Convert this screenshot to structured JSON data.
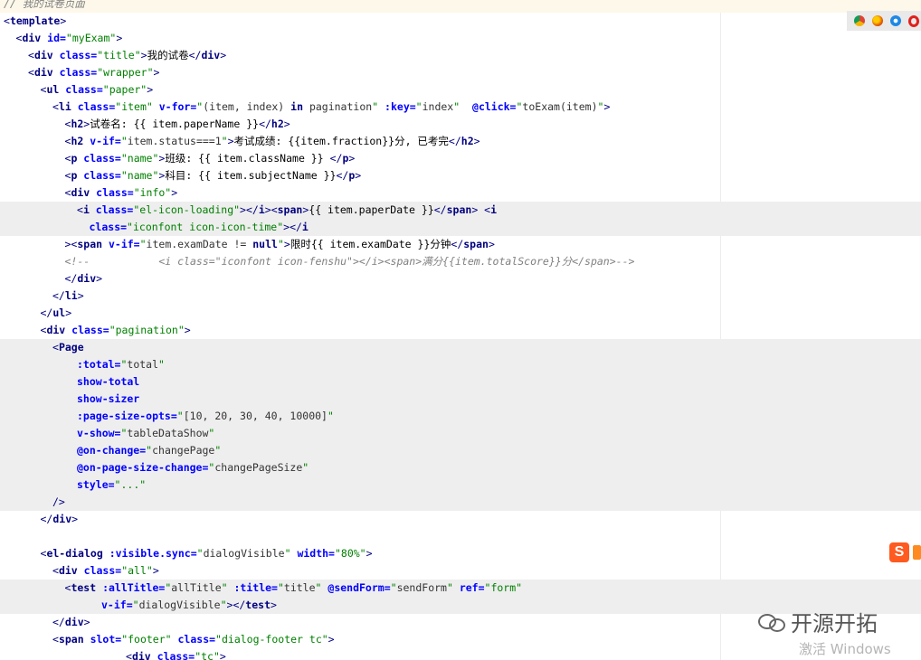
{
  "lines": [
    {
      "indent": 0,
      "hl": "first",
      "segs": [
        [
          "cmt",
          "// 我的试卷页面"
        ]
      ]
    },
    {
      "indent": 0,
      "hl": "",
      "segs": [
        [
          "tag",
          "<"
        ],
        [
          "kw",
          "template"
        ],
        [
          "tag",
          ">"
        ]
      ]
    },
    {
      "indent": 1,
      "hl": "",
      "segs": [
        [
          "tag",
          "<"
        ],
        [
          "kw",
          "div "
        ],
        [
          "attr",
          "id="
        ],
        [
          "val",
          "\"myExam\""
        ],
        [
          "tag",
          ">"
        ]
      ]
    },
    {
      "indent": 2,
      "hl": "",
      "segs": [
        [
          "tag",
          "<"
        ],
        [
          "kw",
          "div "
        ],
        [
          "attr",
          "class="
        ],
        [
          "val",
          "\"title\""
        ],
        [
          "tag",
          ">"
        ],
        [
          "txt",
          "我的试卷"
        ],
        [
          "tag",
          "</"
        ],
        [
          "kw",
          "div"
        ],
        [
          "tag",
          ">"
        ]
      ]
    },
    {
      "indent": 2,
      "hl": "",
      "segs": [
        [
          "tag",
          "<"
        ],
        [
          "kw",
          "div "
        ],
        [
          "attr",
          "class="
        ],
        [
          "val",
          "\"wrapper\""
        ],
        [
          "tag",
          ">"
        ]
      ]
    },
    {
      "indent": 3,
      "hl": "",
      "segs": [
        [
          "tag",
          "<"
        ],
        [
          "kw",
          "ul "
        ],
        [
          "attr",
          "class="
        ],
        [
          "val",
          "\"paper\""
        ],
        [
          "tag",
          ">"
        ]
      ]
    },
    {
      "indent": 4,
      "hl": "",
      "segs": [
        [
          "tag",
          "<"
        ],
        [
          "kw",
          "li "
        ],
        [
          "attr",
          "class="
        ],
        [
          "val",
          "\"item\" "
        ],
        [
          "attr",
          "v-for="
        ],
        [
          "val",
          "\""
        ],
        [
          "plain",
          "(item, index) "
        ],
        [
          "kw",
          "in "
        ],
        [
          "plain",
          "pagination"
        ],
        [
          "val",
          "\" "
        ],
        [
          "attr",
          ":key="
        ],
        [
          "val",
          "\""
        ],
        [
          "plain",
          "index"
        ],
        [
          "val",
          "\"  "
        ],
        [
          "attr",
          "@click="
        ],
        [
          "val",
          "\""
        ],
        [
          "plain",
          "toExam(item)"
        ],
        [
          "val",
          "\""
        ],
        [
          "tag",
          ">"
        ]
      ]
    },
    {
      "indent": 5,
      "hl": "",
      "segs": [
        [
          "tag",
          "<"
        ],
        [
          "kw",
          "h2"
        ],
        [
          "tag",
          ">"
        ],
        [
          "txt",
          "试卷名: {{ item.paperName }}"
        ],
        [
          "tag",
          "</"
        ],
        [
          "kw",
          "h2"
        ],
        [
          "tag",
          ">"
        ]
      ]
    },
    {
      "indent": 5,
      "hl": "",
      "segs": [
        [
          "tag",
          "<"
        ],
        [
          "kw",
          "h2 "
        ],
        [
          "attr",
          "v-if="
        ],
        [
          "val",
          "\""
        ],
        [
          "plain",
          "item.status===1"
        ],
        [
          "val",
          "\""
        ],
        [
          "tag",
          ">"
        ],
        [
          "txt",
          "考试成绩: {{item.fraction}}分, 已考完"
        ],
        [
          "tag",
          "</"
        ],
        [
          "kw",
          "h2"
        ],
        [
          "tag",
          ">"
        ]
      ]
    },
    {
      "indent": 5,
      "hl": "",
      "segs": [
        [
          "tag",
          "<"
        ],
        [
          "kw",
          "p "
        ],
        [
          "attr",
          "class="
        ],
        [
          "val",
          "\"name\""
        ],
        [
          "tag",
          ">"
        ],
        [
          "txt",
          "班级: {{ item.className }} "
        ],
        [
          "tag",
          "</"
        ],
        [
          "kw",
          "p"
        ],
        [
          "tag",
          ">"
        ]
      ]
    },
    {
      "indent": 5,
      "hl": "",
      "segs": [
        [
          "tag",
          "<"
        ],
        [
          "kw",
          "p "
        ],
        [
          "attr",
          "class="
        ],
        [
          "val",
          "\"name\""
        ],
        [
          "tag",
          ">"
        ],
        [
          "txt",
          "科目: {{ item.subjectName }}"
        ],
        [
          "tag",
          "</"
        ],
        [
          "kw",
          "p"
        ],
        [
          "tag",
          ">"
        ]
      ]
    },
    {
      "indent": 5,
      "hl": "",
      "segs": [
        [
          "tag",
          "<"
        ],
        [
          "kw",
          "div "
        ],
        [
          "attr",
          "class="
        ],
        [
          "val",
          "\"info\""
        ],
        [
          "tag",
          ">"
        ]
      ]
    },
    {
      "indent": 6,
      "hl": "hl",
      "segs": [
        [
          "tag",
          "<"
        ],
        [
          "kw",
          "i "
        ],
        [
          "attr",
          "class="
        ],
        [
          "val",
          "\"el-icon-loading\""
        ],
        [
          "tag",
          "></"
        ],
        [
          "kw",
          "i"
        ],
        [
          "tag",
          "><"
        ],
        [
          "kw",
          "span"
        ],
        [
          "tag",
          ">"
        ],
        [
          "txt",
          "{{ item.paperDate }}"
        ],
        [
          "tag",
          "</"
        ],
        [
          "kw",
          "span"
        ],
        [
          "tag",
          "> <"
        ],
        [
          "kw",
          "i"
        ]
      ]
    },
    {
      "indent": 7,
      "hl": "hl",
      "segs": [
        [
          "attr",
          "class="
        ],
        [
          "val",
          "\"iconfont icon-icon-time\""
        ],
        [
          "tag",
          "></"
        ],
        [
          "kw",
          "i"
        ]
      ]
    },
    {
      "indent": 5,
      "hl": "",
      "segs": [
        [
          "tag",
          "><"
        ],
        [
          "kw",
          "span "
        ],
        [
          "attr",
          "v-if="
        ],
        [
          "val",
          "\""
        ],
        [
          "plain",
          "item.examDate != "
        ],
        [
          "kw",
          "null"
        ],
        [
          "val",
          "\""
        ],
        [
          "tag",
          ">"
        ],
        [
          "txt",
          "限时{{ item.examDate }}分钟"
        ],
        [
          "tag",
          "</"
        ],
        [
          "kw",
          "span"
        ],
        [
          "tag",
          ">"
        ]
      ]
    },
    {
      "indent": 5,
      "hl": "",
      "segs": [
        [
          "cmt",
          "<!--           <i class=\"iconfont icon-fenshu\"></i><span>满分{{item.totalScore}}分</span>-->"
        ]
      ]
    },
    {
      "indent": 5,
      "hl": "",
      "segs": [
        [
          "tag",
          "</"
        ],
        [
          "kw",
          "div"
        ],
        [
          "tag",
          ">"
        ]
      ]
    },
    {
      "indent": 4,
      "hl": "",
      "segs": [
        [
          "tag",
          "</"
        ],
        [
          "kw",
          "li"
        ],
        [
          "tag",
          ">"
        ]
      ]
    },
    {
      "indent": 3,
      "hl": "",
      "segs": [
        [
          "tag",
          "</"
        ],
        [
          "kw",
          "ul"
        ],
        [
          "tag",
          ">"
        ]
      ]
    },
    {
      "indent": 3,
      "hl": "",
      "segs": [
        [
          "tag",
          "<"
        ],
        [
          "kw",
          "div "
        ],
        [
          "attr",
          "class="
        ],
        [
          "val",
          "\"pagination\""
        ],
        [
          "tag",
          ">"
        ]
      ]
    },
    {
      "indent": 4,
      "hl": "hl",
      "segs": [
        [
          "tag",
          "<"
        ],
        [
          "kw",
          "Page"
        ]
      ]
    },
    {
      "indent": 6,
      "hl": "hl",
      "segs": [
        [
          "attr",
          ":total="
        ],
        [
          "val",
          "\""
        ],
        [
          "plain",
          "total"
        ],
        [
          "val",
          "\""
        ]
      ]
    },
    {
      "indent": 6,
      "hl": "hl",
      "segs": [
        [
          "attr",
          "show-total"
        ]
      ]
    },
    {
      "indent": 6,
      "hl": "hl",
      "segs": [
        [
          "attr",
          "show-sizer"
        ]
      ]
    },
    {
      "indent": 6,
      "hl": "hl",
      "segs": [
        [
          "attr",
          ":page-size-opts="
        ],
        [
          "val",
          "\""
        ],
        [
          "plain",
          "[10, 20, 30, 40, 10000]"
        ],
        [
          "val",
          "\""
        ]
      ]
    },
    {
      "indent": 6,
      "hl": "hl",
      "segs": [
        [
          "attr",
          "v-show="
        ],
        [
          "val",
          "\""
        ],
        [
          "plain",
          "tableDataShow"
        ],
        [
          "val",
          "\""
        ]
      ]
    },
    {
      "indent": 6,
      "hl": "hl",
      "segs": [
        [
          "attr",
          "@on-change="
        ],
        [
          "val",
          "\""
        ],
        [
          "plain",
          "changePage"
        ],
        [
          "val",
          "\""
        ]
      ]
    },
    {
      "indent": 6,
      "hl": "hl",
      "segs": [
        [
          "attr",
          "@on-page-size-change="
        ],
        [
          "val",
          "\""
        ],
        [
          "plain",
          "changePageSize"
        ],
        [
          "val",
          "\""
        ]
      ]
    },
    {
      "indent": 6,
      "hl": "hl",
      "segs": [
        [
          "attr",
          "style="
        ],
        [
          "val",
          "\"...\""
        ]
      ]
    },
    {
      "indent": 4,
      "hl": "hl",
      "segs": [
        [
          "tag",
          "/>"
        ]
      ]
    },
    {
      "indent": 3,
      "hl": "",
      "segs": [
        [
          "tag",
          "</"
        ],
        [
          "kw",
          "div"
        ],
        [
          "tag",
          ">"
        ]
      ]
    },
    {
      "indent": 0,
      "hl": "",
      "segs": []
    },
    {
      "indent": 3,
      "hl": "",
      "segs": [
        [
          "tag",
          "<"
        ],
        [
          "kw",
          "el-dialog "
        ],
        [
          "attr",
          ":visible.sync="
        ],
        [
          "val",
          "\""
        ],
        [
          "plain",
          "dialogVisible"
        ],
        [
          "val",
          "\" "
        ],
        [
          "attr",
          "width="
        ],
        [
          "val",
          "\"80%\""
        ],
        [
          "tag",
          ">"
        ]
      ]
    },
    {
      "indent": 4,
      "hl": "",
      "segs": [
        [
          "tag",
          "<"
        ],
        [
          "kw",
          "div "
        ],
        [
          "attr",
          "class="
        ],
        [
          "val",
          "\"all\""
        ],
        [
          "tag",
          ">"
        ]
      ]
    },
    {
      "indent": 5,
      "hl": "hl",
      "segs": [
        [
          "tag",
          "<"
        ],
        [
          "kw",
          "test "
        ],
        [
          "attr",
          ":allTitle="
        ],
        [
          "val",
          "\""
        ],
        [
          "plain",
          "allTitle"
        ],
        [
          "val",
          "\" "
        ],
        [
          "attr",
          ":title="
        ],
        [
          "val",
          "\""
        ],
        [
          "plain",
          "title"
        ],
        [
          "val",
          "\" "
        ],
        [
          "attr",
          "@sendForm="
        ],
        [
          "val",
          "\""
        ],
        [
          "plain",
          "sendForm"
        ],
        [
          "val",
          "\" "
        ],
        [
          "attr",
          "ref="
        ],
        [
          "val",
          "\"form\""
        ]
      ]
    },
    {
      "indent": 8,
      "hl": "hl",
      "segs": [
        [
          "attr",
          "v-if="
        ],
        [
          "val",
          "\""
        ],
        [
          "plain",
          "dialogVisible"
        ],
        [
          "val",
          "\""
        ],
        [
          "tag",
          "></"
        ],
        [
          "kw",
          "test"
        ],
        [
          "tag",
          ">"
        ]
      ]
    },
    {
      "indent": 4,
      "hl": "",
      "segs": [
        [
          "tag",
          "</"
        ],
        [
          "kw",
          "div"
        ],
        [
          "tag",
          ">"
        ]
      ]
    },
    {
      "indent": 4,
      "hl": "",
      "segs": [
        [
          "tag",
          "<"
        ],
        [
          "kw",
          "span "
        ],
        [
          "attr",
          "slot="
        ],
        [
          "val",
          "\"footer\" "
        ],
        [
          "attr",
          "class="
        ],
        [
          "val",
          "\"dialog-footer tc\""
        ],
        [
          "tag",
          ">"
        ]
      ]
    },
    {
      "indent": 10,
      "hl": "",
      "segs": [
        [
          "tag",
          "<"
        ],
        [
          "kw",
          "div "
        ],
        [
          "attr",
          "class="
        ],
        [
          "val",
          "\"tc\""
        ],
        [
          "tag",
          ">"
        ]
      ]
    }
  ],
  "overlay": {
    "browser_icons": [
      "chrome-icon",
      "firefox-icon",
      "ie-icon",
      "opera-icon"
    ],
    "watermark_text": "开源开拓",
    "activate_text": "激活 Windows"
  }
}
